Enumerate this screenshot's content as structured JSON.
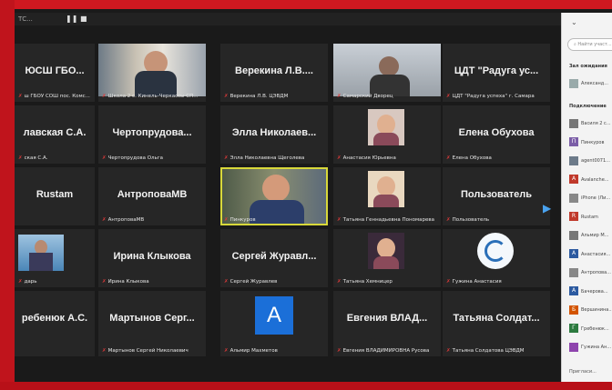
{
  "window": {
    "title": "ТС...",
    "pause_glyph": "❚❚ ■",
    "clock": "0:52"
  },
  "grid": {
    "tiles": [
      {
        "name": "",
        "label": "ЮСШ ГБО...",
        "sub": "ш ГБОУ СОШ пос. Комс...",
        "kind": "text-name"
      },
      {
        "name": "",
        "label": "",
        "sub": "Школа  2 с. Кинель-Черкассы СП...",
        "kind": "video-man"
      },
      {
        "name": "Верекина Л.В....",
        "sub": "Верекина Л.В. ЦЭВДМ",
        "kind": "text-name"
      },
      {
        "name": "",
        "sub": "Самарский Дворец",
        "kind": "video-man2"
      },
      {
        "name": "ЦДТ \"Радуга ус...",
        "sub": "ЦДТ \"Радуга успеха\" г. Самара",
        "kind": "text-name"
      },
      {
        "name": "лавская С.А.",
        "sub": "ская С.А.",
        "kind": "text-name"
      },
      {
        "name": "Чертопрудова...",
        "sub": "Чертопрудова Ольга",
        "kind": "text-name"
      },
      {
        "name": "Элла Николаев...",
        "sub": "Элла Николаевна Щеголева",
        "kind": "text-name"
      },
      {
        "name": "",
        "sub": "Анастасия Юрьевна",
        "kind": "photo-woman"
      },
      {
        "name": "Елена Обухова",
        "sub": "Елена Обухова",
        "kind": "text-name"
      },
      {
        "name": "Rustam",
        "sub": "",
        "kind": "text-name"
      },
      {
        "name": "АнтроповаМВ",
        "sub": "АнтроповаМВ",
        "kind": "text-name"
      },
      {
        "name": "",
        "sub": "Пинкуров",
        "kind": "video-active"
      },
      {
        "name": "",
        "sub": "Татьяна Геннадьевна Пономарева",
        "kind": "photo-child"
      },
      {
        "name": "Пользователь",
        "sub": "Пользователь",
        "kind": "text-name"
      },
      {
        "name": "",
        "sub": "дарь",
        "kind": "photo-sea"
      },
      {
        "name": "Ирина Клыкова",
        "sub": "Ирина Клыкова",
        "kind": "text-name"
      },
      {
        "name": "Сергей Журавл...",
        "sub": "Сергей Журавлев",
        "kind": "text-name"
      },
      {
        "name": "",
        "sub": "Татьяна Хемницер",
        "kind": "photo-woman2"
      },
      {
        "name": "",
        "sub": "Гужина Анастасия",
        "kind": "logo"
      },
      {
        "name": "ребенюк А.С.",
        "sub": "",
        "kind": "text-name"
      },
      {
        "name": "Мартынов Серг...",
        "sub": "Мартынов Сергей Николаевич",
        "kind": "text-name"
      },
      {
        "name": "",
        "sub": "Альмир Махметов",
        "kind": "avatar",
        "letter": "A"
      },
      {
        "name": "Евгения ВЛАД...",
        "sub": "Евгения ВЛАДИМИРОВНА Русова",
        "kind": "text-name"
      },
      {
        "name": "Татьяна Солдат...",
        "sub": "Татьяна Солдатова ЦЭВДМ",
        "kind": "text-name"
      }
    ]
  },
  "sidebar": {
    "search_placeholder": "Найти участ...",
    "waiting_section": "Зал ожидания",
    "connected_section": "Подключение",
    "waiting": [
      {
        "name": "Александ...",
        "color": "#9aa"
      }
    ],
    "participants": [
      {
        "name": "Василя 2 с...",
        "color": "#777",
        "letter": ""
      },
      {
        "name": "Пинкуров",
        "color": "#7b5ea7",
        "letter": "П"
      },
      {
        "name": "agent0071...",
        "color": "#6c7a89",
        "letter": ""
      },
      {
        "name": "Avalanche...",
        "color": "#c0392b",
        "letter": "A"
      },
      {
        "name": "iPhone (Ли...",
        "color": "#888",
        "letter": ""
      },
      {
        "name": "Rustam",
        "color": "#c0392b",
        "letter": "R"
      },
      {
        "name": "Альмир М...",
        "color": "#777",
        "letter": ""
      },
      {
        "name": "Анастасия...",
        "color": "#2c5aa0",
        "letter": "A"
      },
      {
        "name": "Антропова...",
        "color": "#888",
        "letter": ""
      },
      {
        "name": "Бачерова...",
        "color": "#2c5aa0",
        "letter": "A"
      },
      {
        "name": "Вершинина...",
        "color": "#d35400",
        "letter": "Б"
      },
      {
        "name": "Гребенюк...",
        "color": "#2c7a3f",
        "letter": "Г"
      },
      {
        "name": "Гужина Ан...",
        "color": "#8e44ad",
        "letter": ""
      }
    ],
    "invite_label": "Пригласи..."
  }
}
